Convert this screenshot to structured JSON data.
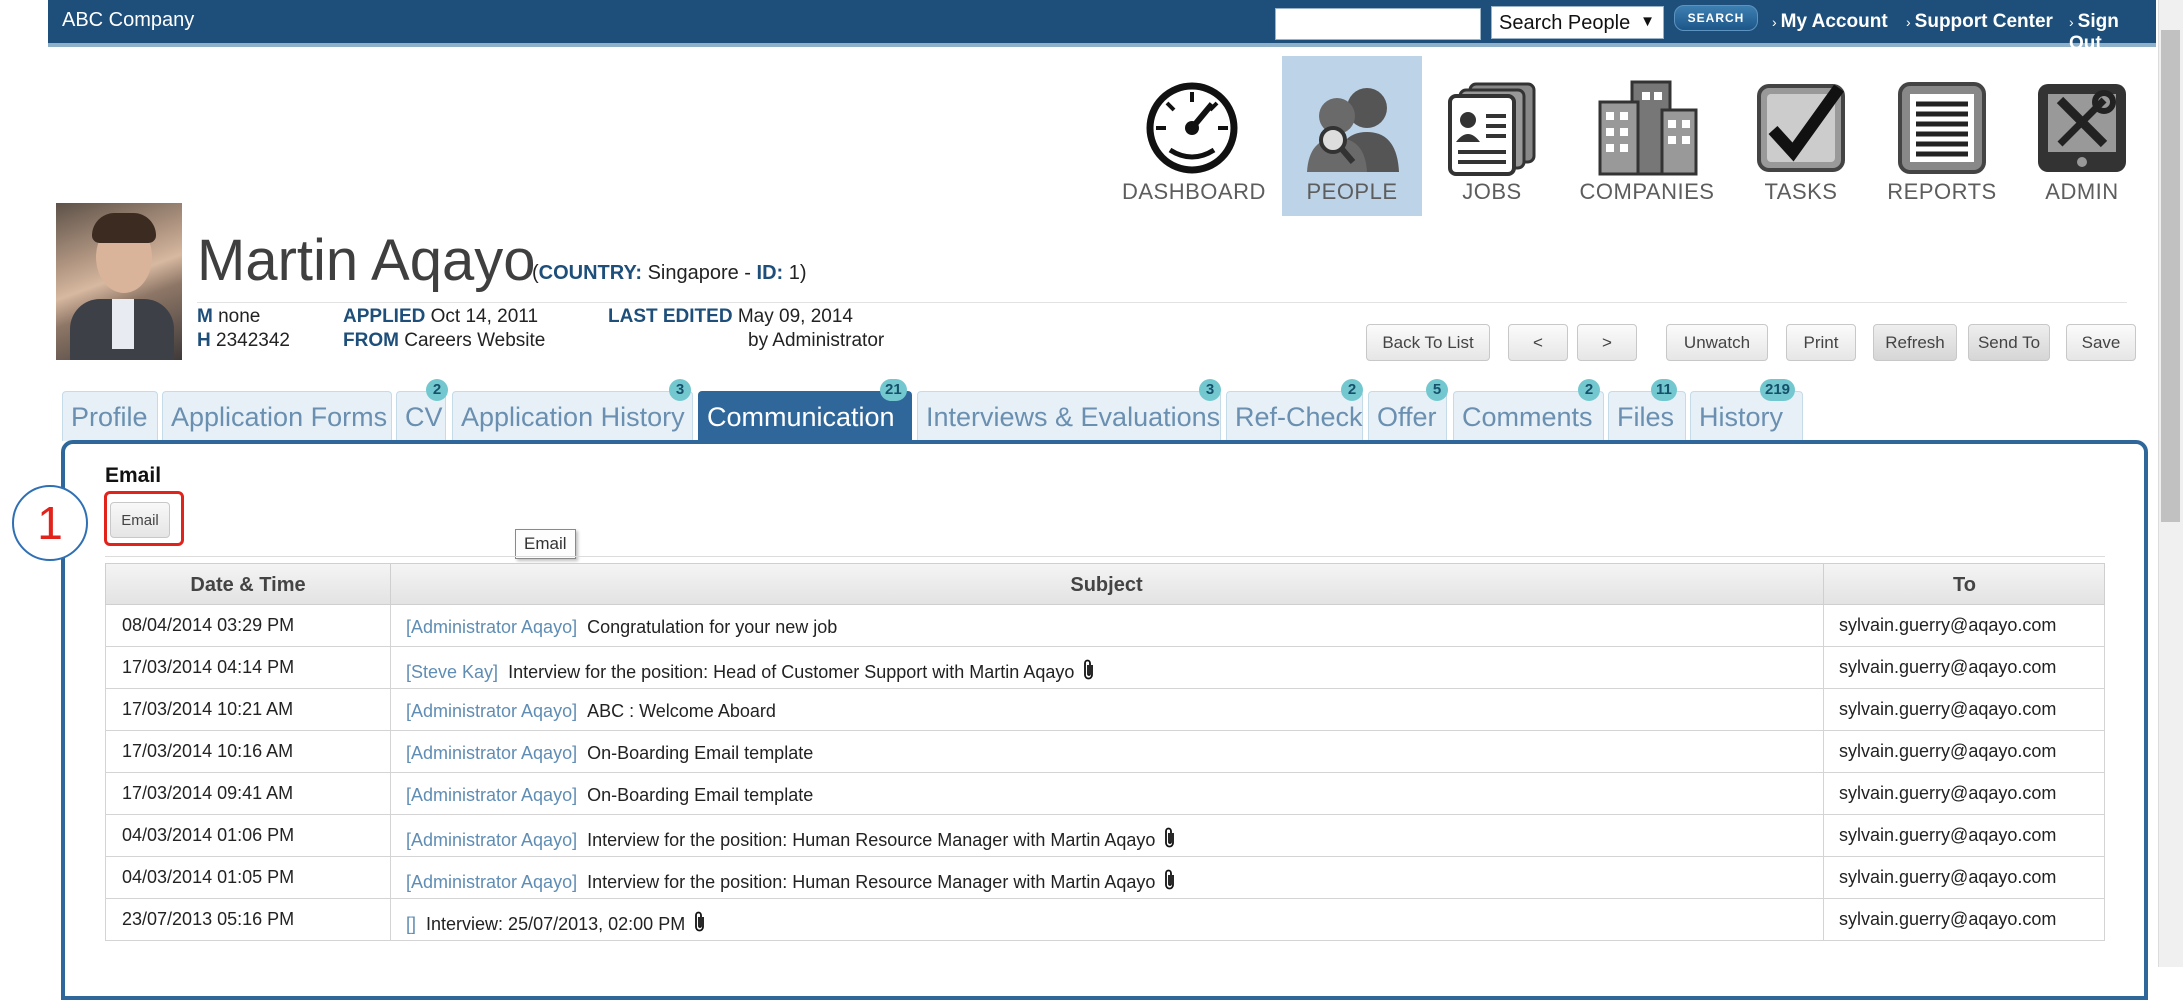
{
  "topbar": {
    "company": "ABC Company",
    "search_value": "",
    "search_select": "Search People",
    "search_button": "SEARCH",
    "links": [
      "My Account",
      "Support Center",
      "Sign Out"
    ]
  },
  "nav": [
    {
      "label": "DASHBOARD",
      "icon": "dashboard-gauge-icon",
      "active": false
    },
    {
      "label": "PEOPLE",
      "icon": "people-icon",
      "active": true
    },
    {
      "label": "JOBS",
      "icon": "jobs-icon",
      "active": false
    },
    {
      "label": "COMPANIES",
      "icon": "companies-icon",
      "active": false
    },
    {
      "label": "TASKS",
      "icon": "tasks-check-icon",
      "active": false
    },
    {
      "label": "REPORTS",
      "icon": "reports-icon",
      "active": false
    },
    {
      "label": "ADMIN",
      "icon": "admin-tools-icon",
      "active": false
    }
  ],
  "candidate": {
    "name": "Martin Aqayo",
    "country_label": "COUNTRY:",
    "country": "Singapore",
    "id_label": "ID:",
    "id": "1",
    "m_label": "M",
    "m_value": "none",
    "h_label": "H",
    "h_value": "2342342",
    "applied_label": "APPLIED",
    "applied": "Oct 14, 2011",
    "from_label": "FROM",
    "from": "Careers Website",
    "last_edited_label": "LAST EDITED",
    "last_edited": "May 09, 2014",
    "edited_by": "by Administrator"
  },
  "actions": [
    "Back To List",
    "<",
    ">",
    "Unwatch",
    "Print",
    "Refresh",
    "Send To",
    "Save"
  ],
  "tabs": [
    {
      "label": "Profile",
      "badge": ""
    },
    {
      "label": "Application Forms",
      "badge": ""
    },
    {
      "label": "CV",
      "badge": "2"
    },
    {
      "label": "Application History",
      "badge": "3"
    },
    {
      "label": "Communication",
      "badge": "21",
      "active": true
    },
    {
      "label": "Interviews & Evaluations",
      "badge": "3"
    },
    {
      "label": "Ref-Check",
      "badge": "2"
    },
    {
      "label": "Offer",
      "badge": "5"
    },
    {
      "label": "Comments",
      "badge": "2"
    },
    {
      "label": "Files",
      "badge": "11"
    },
    {
      "label": "History",
      "badge": "219"
    }
  ],
  "email_section": {
    "title": "Email",
    "button": "Email",
    "tooltip": "Email",
    "step_marker": "1"
  },
  "table": {
    "headers": [
      "Date & Time",
      "Subject",
      "To"
    ],
    "rows": [
      {
        "date": "08/04/2014 03:29 PM",
        "author": "[Administrator Aqayo]",
        "subject": "Congratulation for your new job",
        "attachment": false,
        "to": "sylvain.guerry@aqayo.com"
      },
      {
        "date": "17/03/2014 04:14 PM",
        "author": "[Steve Kay]",
        "subject": "Interview for the position: Head of Customer Support with Martin Aqayo",
        "attachment": true,
        "to": "sylvain.guerry@aqayo.com"
      },
      {
        "date": "17/03/2014 10:21 AM",
        "author": "[Administrator Aqayo]",
        "subject": "ABC : Welcome Aboard",
        "attachment": false,
        "to": "sylvain.guerry@aqayo.com"
      },
      {
        "date": "17/03/2014 10:16 AM",
        "author": "[Administrator Aqayo]",
        "subject": "On-Boarding Email template",
        "attachment": false,
        "to": "sylvain.guerry@aqayo.com"
      },
      {
        "date": "17/03/2014 09:41 AM",
        "author": "[Administrator Aqayo]",
        "subject": "On-Boarding Email template",
        "attachment": false,
        "to": "sylvain.guerry@aqayo.com"
      },
      {
        "date": "04/03/2014 01:06 PM",
        "author": "[Administrator Aqayo]",
        "subject": "Interview for the position: Human Resource Manager with Martin Aqayo",
        "attachment": true,
        "to": "sylvain.guerry@aqayo.com"
      },
      {
        "date": "04/03/2014 01:05 PM",
        "author": "[Administrator Aqayo]",
        "subject": "Interview for the position: Human Resource Manager with Martin Aqayo",
        "attachment": true,
        "to": "sylvain.guerry@aqayo.com"
      },
      {
        "date": "23/07/2013 05:16 PM",
        "author": "[]",
        "subject": "Interview: 25/07/2013, 02:00 PM",
        "attachment": true,
        "to": "sylvain.guerry@aqayo.com"
      }
    ]
  }
}
